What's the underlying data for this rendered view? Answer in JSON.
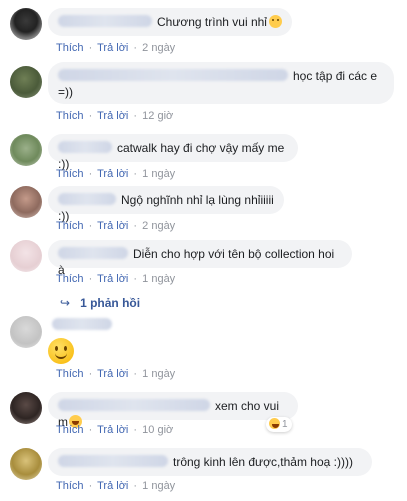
{
  "labels": {
    "like": "Thích",
    "reply": "Trả lời",
    "sep": "·"
  },
  "comments": [
    {
      "text": "Chương trình vui nhỉ",
      "time": "2 ngày",
      "emoji": "smile-icon"
    },
    {
      "text": "học tập đi các e =))",
      "text_line1": "học tập đi các e",
      "text_line2": "=))",
      "time": "12 giờ"
    },
    {
      "text": "catwalk hay đi chợ vậy mấy me :))",
      "time": "1 ngày"
    },
    {
      "text": "Ngộ nghĩnh nhỉ lạ lùng nhỉiiiii :))",
      "time": "2 ngày"
    },
    {
      "text": "Diễn cho hợp với tên bộ collection hoi à",
      "time": "1 ngày",
      "replies_label": "1 phản hồi"
    },
    {
      "text": "",
      "time": "1 ngày",
      "emoji": "big-smile-icon"
    },
    {
      "text": "xem cho vui m",
      "time": "10 giờ",
      "emoji": "laughing-emoji-icon",
      "reaction_count": "1"
    },
    {
      "text": "trông kinh lên được,thảm hoạ :))))",
      "time": "1 ngày"
    }
  ],
  "colors": {
    "link": "#4267b2",
    "bubble": "#f2f3f5",
    "meta": "#90949c"
  }
}
